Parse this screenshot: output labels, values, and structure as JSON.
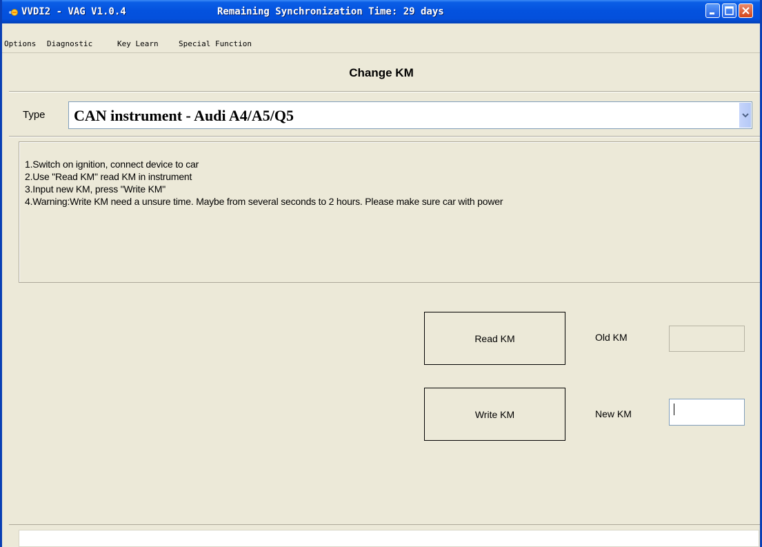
{
  "window": {
    "title": "VVDI2 - VAG V1.0.4",
    "sync_text": "Remaining Synchronization Time: 29 days",
    "controls": {
      "minimize": "minimize",
      "maximize": "maximize",
      "close": "close"
    }
  },
  "menu": {
    "items": [
      {
        "label": "Options"
      },
      {
        "label": "Diagnostic"
      },
      {
        "label": "Key Learn"
      },
      {
        "label": "Special Function"
      }
    ]
  },
  "page": {
    "title": "Change KM"
  },
  "type": {
    "label": "Type",
    "selected": "CAN instrument - Audi A4/A5/Q5"
  },
  "instructions": [
    "1.Switch on ignition, connect device to car",
    "2.Use \"Read KM\" read KM in instrument",
    "3.Input new KM, press \"Write KM\"",
    "4.Warning:Write KM need a unsure time. Maybe from several seconds to 2 hours. Please make sure car with power"
  ],
  "actions": {
    "read_label": "Read KM",
    "write_label": "Write KM"
  },
  "fields": {
    "old_label": "Old KM",
    "old_value": "",
    "new_label": "New KM",
    "new_value": ""
  },
  "status": {
    "text": ""
  },
  "icons": {
    "app": "vvdi-app-icon",
    "dropdown": "chevron-down-icon"
  },
  "colors": {
    "titlebar": "#0452de",
    "window_bg": "#ece9d8",
    "close_button": "#d2461b"
  }
}
